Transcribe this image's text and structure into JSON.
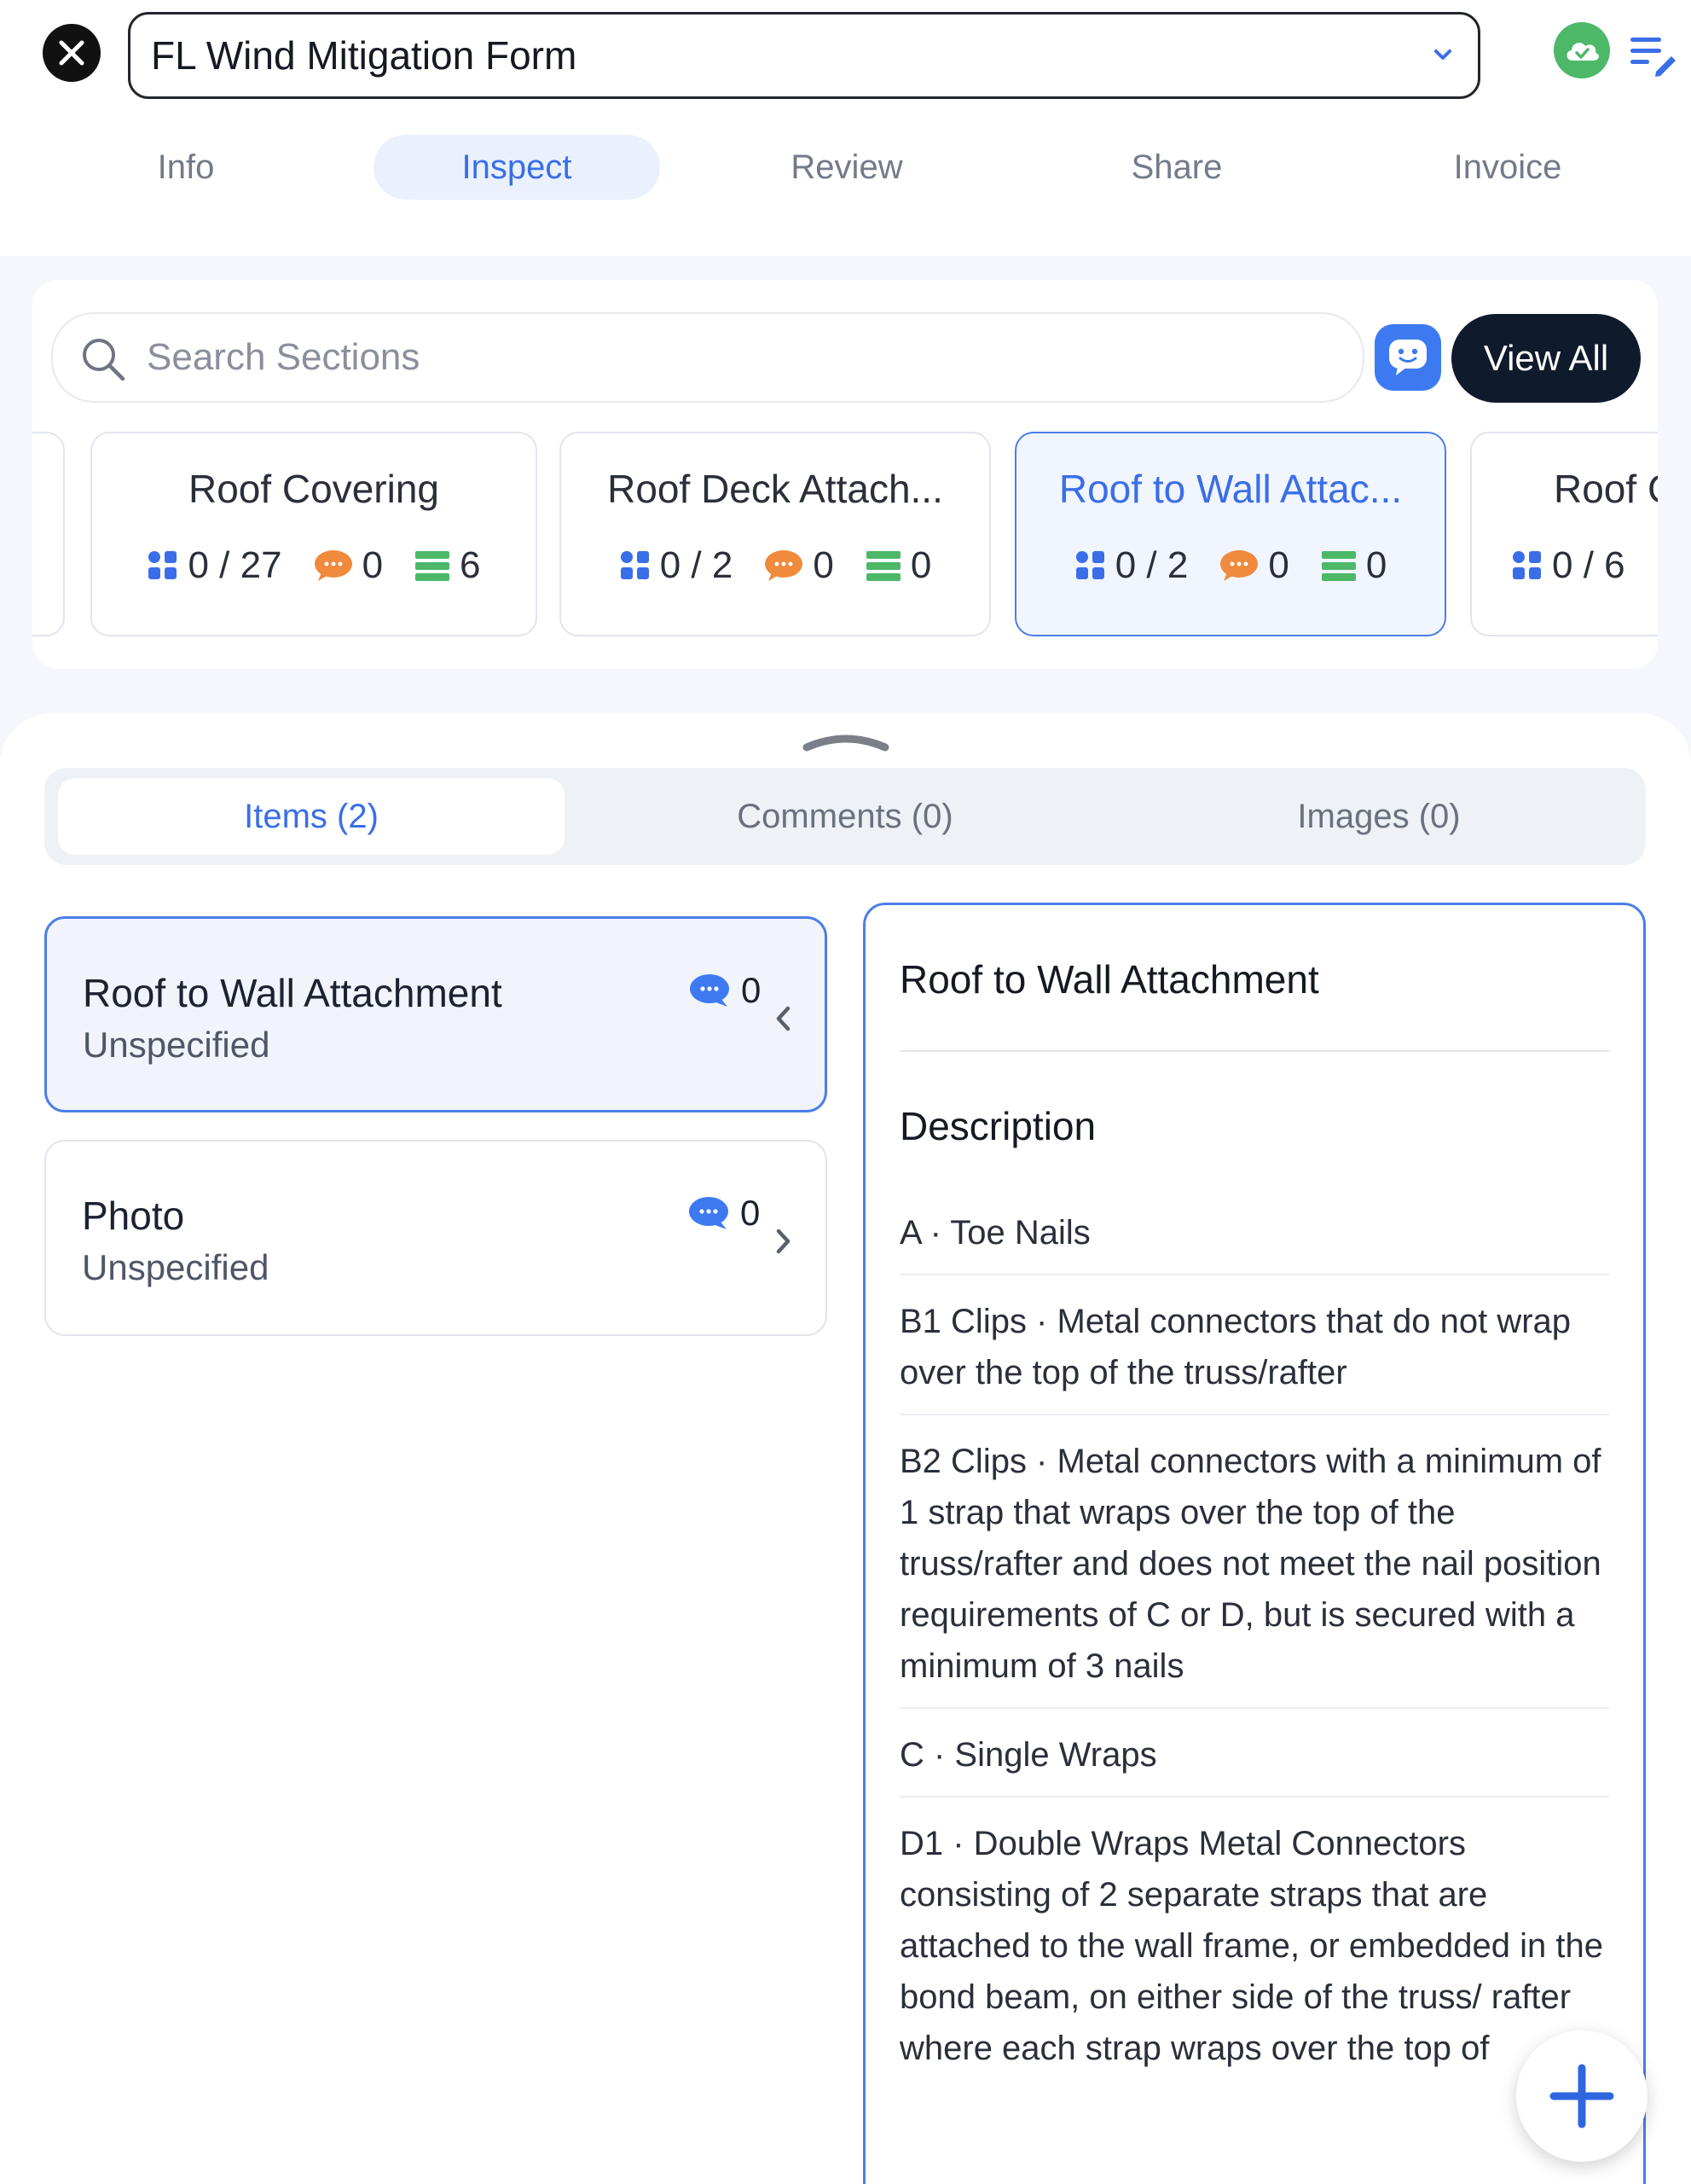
{
  "header": {
    "form_title": "FL Wind Mitigation Form",
    "close_icon": "close-icon",
    "sync_icon": "cloud-check-icon",
    "notes_icon": "list-edit-icon"
  },
  "tabs": [
    {
      "label": "Info",
      "active": false
    },
    {
      "label": "Inspect",
      "active": true
    },
    {
      "label": "Review",
      "active": false
    },
    {
      "label": "Share",
      "active": false
    },
    {
      "label": "Invoice",
      "active": false
    }
  ],
  "search": {
    "placeholder": "Search Sections",
    "view_all_label": "View All"
  },
  "section_cards": [
    {
      "title": "Roof Covering",
      "items": "0 / 27",
      "comments": "0",
      "images": "6",
      "active": false
    },
    {
      "title": "Roof Deck Attach...",
      "items": "0 / 2",
      "comments": "0",
      "images": "0",
      "active": false
    },
    {
      "title": "Roof to Wall Attac...",
      "items": "0 / 2",
      "comments": "0",
      "images": "0",
      "active": true
    },
    {
      "title": "Roof C",
      "items": "0 / 6",
      "comments": "",
      "images": "",
      "active": false
    }
  ],
  "segments": [
    {
      "label": "Items  (2)",
      "active": true
    },
    {
      "label": "Comments  (0)",
      "active": false
    },
    {
      "label": "Images  (0)",
      "active": false
    }
  ],
  "items": [
    {
      "name": "Roof to Wall Attachment",
      "status": "Unspecified",
      "comments": "0",
      "active": true
    },
    {
      "name": "Photo",
      "status": "Unspecified",
      "comments": "0",
      "active": false
    }
  ],
  "detail": {
    "title": "Roof to Wall Attachment",
    "description_label": "Description",
    "options": [
      "A · Toe Nails",
      "B1 Clips · Metal connectors that do not wrap over the top of the truss/rafter",
      "B2 Clips ·  Metal connectors with a minimum of 1 strap that wraps over the top of the truss/rafter and does not meet the nail position requirements of C or D, but is secured with a minimum of 3 nails",
      "C · Single Wraps",
      "D1 · Double Wraps Metal Connectors consisting of 2 separate straps that are attached to the wall frame, or embedded in the bond beam, on either side of the truss/ rafter where each strap wraps over the top of"
    ]
  },
  "colors": {
    "accent": "#3a6ee8",
    "dark_button": "#101a2d",
    "comment_badge": "#f08a3c",
    "image_badge": "#4cb868",
    "sync_green": "#4cb868"
  }
}
